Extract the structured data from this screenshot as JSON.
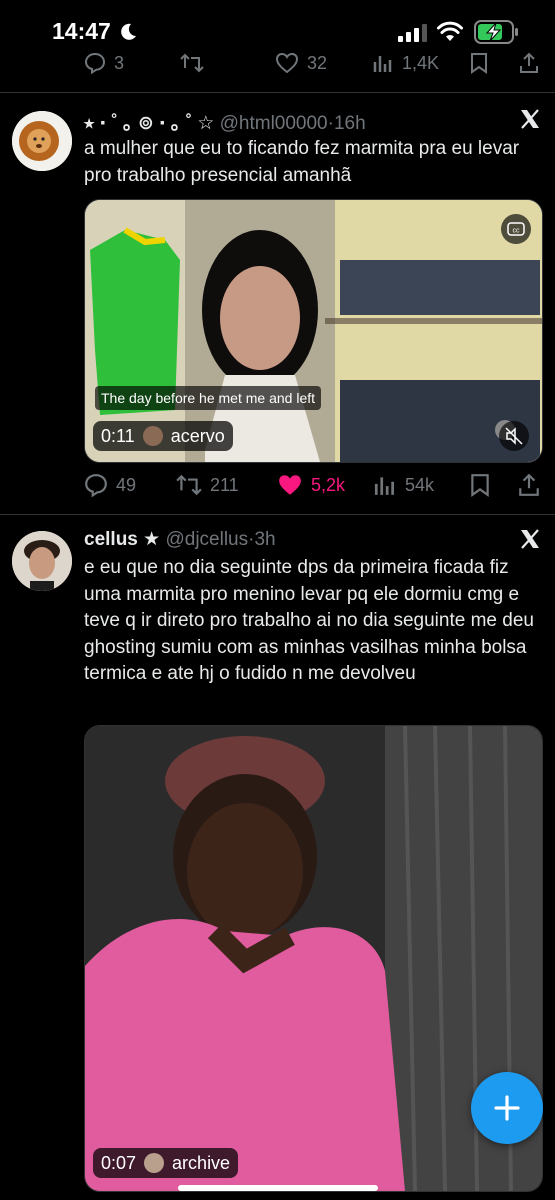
{
  "status_bar": {
    "time": "14:47"
  },
  "prev_tweet_actions": {
    "replies": "3",
    "likes": "32",
    "views": "1,4K"
  },
  "tweet1": {
    "author_name": "⭑ ‧ ˚ ｡ ⊚ ‧ ｡ ˚ ☆",
    "handle": "@html00000",
    "sep": "·",
    "time": "16h",
    "text": "a mulher que eu to ficando fez marmita pra eu levar pro trabalho presencial amanhã",
    "video": {
      "caption": "The day before he met me and left",
      "duration": "0:11",
      "source": "acervo",
      "cc_label": "cc"
    },
    "actions": {
      "replies": "49",
      "retweets": "211",
      "likes": "5,2k",
      "views": "54k"
    }
  },
  "tweet2": {
    "author_name": "cellus ★",
    "handle": "@djcellus",
    "sep": "·",
    "time": "3h",
    "text": "e eu que no dia seguinte dps da primeira ficada fiz uma marmita pro menino levar pq ele dormiu cmg e teve q ir direto pro trabalho ai no dia seguinte me deu ghosting sumiu com as minhas vasilhas minha bolsa termica e ate hj o fudido n me devolveu",
    "video": {
      "duration": "0:07",
      "source": "archive"
    }
  },
  "fab": {
    "icon": "plus-icon"
  },
  "colors": {
    "background": "#000000",
    "accent": "#1d9bf0",
    "like": "#f91880",
    "muted": "#71767b"
  }
}
